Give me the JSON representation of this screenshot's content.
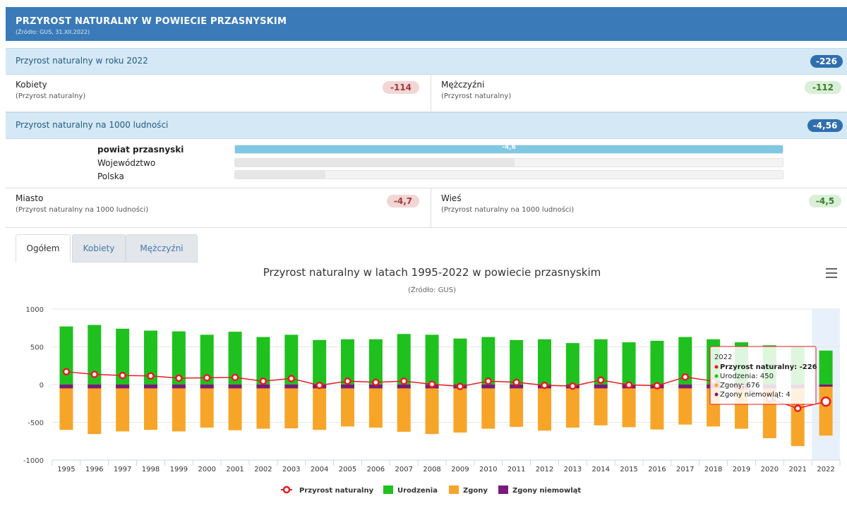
{
  "header": {
    "title": "PRZYROST NATURALNY W POWIECIE PRZASNYSKIM",
    "source": "(Źródło: GUS, 31.XII.2022)"
  },
  "summary": {
    "label": "Przyrost naturalny w roku 2022",
    "value": "-226"
  },
  "gender": {
    "women": {
      "label": "Kobiety",
      "sub": "(Przyrost naturalny)",
      "value": "-114"
    },
    "men": {
      "label": "Mężczyźni",
      "sub": "(Przyrost naturalny)",
      "value": "-112"
    }
  },
  "per1000": {
    "label": "Przyrost naturalny na 1000 ludności",
    "value": "-4,56"
  },
  "comparison": [
    {
      "name": "powiat przasnyski",
      "label": "-4,6",
      "fraction": 1.0,
      "color": "#7ec8e3"
    },
    {
      "name": "Województwo",
      "label": "",
      "fraction": 0.51,
      "color": "#e6e6e6"
    },
    {
      "name": "Polska",
      "label": "",
      "fraction": 0.165,
      "color": "#e6e6e6"
    }
  ],
  "urban": {
    "city": {
      "label": "Miasto",
      "sub": "(Przyrost naturalny na 1000 ludności)",
      "value": "-4,7"
    },
    "village": {
      "label": "Wieś",
      "sub": "(Przyrost naturalny na 1000 ludności)",
      "value": "-4,5"
    }
  },
  "tabs": [
    "Ogółem",
    "Kobiety",
    "Mężczyźni"
  ],
  "chart_data": {
    "type": "bar",
    "title": "Przyrost naturalny w latach 1995-2022 w powiecie przasnyskim",
    "subtitle": "(Źródło: GUS)",
    "categories": [
      "1995",
      "1996",
      "1997",
      "1998",
      "1999",
      "2000",
      "2001",
      "2002",
      "2003",
      "2004",
      "2005",
      "2006",
      "2007",
      "2008",
      "2009",
      "2010",
      "2011",
      "2012",
      "2013",
      "2014",
      "2015",
      "2016",
      "2017",
      "2018",
      "2019",
      "2020",
      "2021",
      "2022"
    ],
    "ylim": [
      -1000,
      1000
    ],
    "yticks": [
      1000,
      500,
      0,
      -500,
      -1000
    ],
    "series": [
      {
        "name": "Przyrost naturalny",
        "type": "line",
        "color": "#e51c23",
        "values": [
          170,
          135,
          120,
          115,
          85,
          90,
          95,
          45,
          80,
          -10,
          45,
          30,
          45,
          5,
          -25,
          45,
          30,
          -10,
          -20,
          60,
          -5,
          -15,
          100,
          45,
          -25,
          -190,
          -315,
          -226
        ]
      },
      {
        "name": "Urodzenia",
        "color": "#1fc11f",
        "values": [
          770,
          790,
          740,
          715,
          705,
          660,
          700,
          630,
          660,
          590,
          600,
          600,
          670,
          660,
          610,
          630,
          590,
          600,
          550,
          600,
          560,
          580,
          630,
          600,
          560,
          520,
          500,
          450
        ]
      },
      {
        "name": "Zgony",
        "color": "#f7a529",
        "values": [
          -600,
          -655,
          -620,
          -600,
          -620,
          -570,
          -605,
          -585,
          -580,
          -600,
          -555,
          -570,
          -625,
          -655,
          -635,
          -585,
          -560,
          -610,
          -570,
          -540,
          -565,
          -595,
          -530,
          -555,
          -585,
          -710,
          -815,
          -676
        ]
      },
      {
        "name": "Zgony niemowląt",
        "color": "#7a1a7a",
        "values": [
          -50,
          -50,
          -50,
          -50,
          -50,
          -50,
          -50,
          -50,
          -50,
          -50,
          -50,
          -50,
          -50,
          -50,
          -50,
          -50,
          -50,
          -50,
          -50,
          -50,
          -50,
          -50,
          -50,
          -50,
          -50,
          -50,
          -50,
          -4
        ]
      }
    ],
    "highlight_index": 27,
    "tooltip": {
      "year": "2022",
      "lines": [
        {
          "text": "Przyrost naturalny: -226",
          "color": "#e51c23"
        },
        {
          "text": "Urodzenia: 450",
          "color": "#1fc11f"
        },
        {
          "text": "Zgony: 676",
          "color": "#f7a529"
        },
        {
          "text": "Zgony niemowląt: 4",
          "color": "#7a1a7a"
        }
      ]
    }
  }
}
